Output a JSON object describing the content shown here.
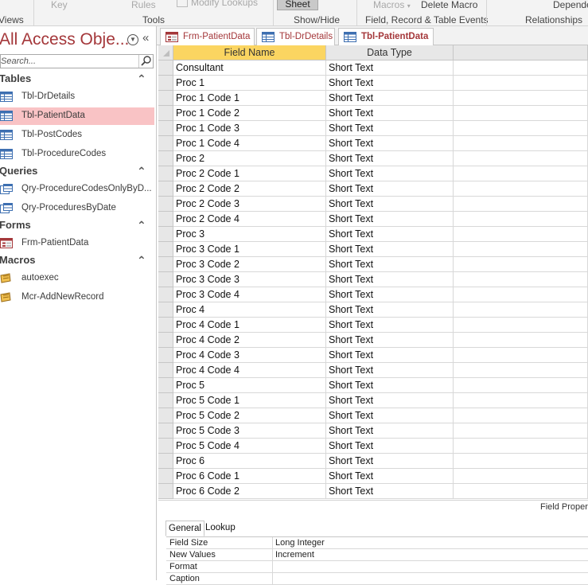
{
  "ribbon": {
    "views_label": "Views",
    "key_label": "Key",
    "rules_label": "Rules",
    "modify_lookups_label": "Modify Lookups",
    "tools_label": "Tools",
    "sheet_label": "Sheet",
    "show_hide_label": "Show/Hide",
    "macros_label": "Macros",
    "delete_macro_label": "Delete Macro",
    "field_events_label": "Field, Record & Table Events",
    "dependencies_label": "Depende",
    "relationships_label": "Relationships"
  },
  "nav": {
    "title": "All Access Obje...",
    "search_placeholder": "Search...",
    "groups": [
      {
        "label": "Tables",
        "items": [
          {
            "label": "Tbl-DrDetails",
            "icon": "table-icon"
          },
          {
            "label": "Tbl-PatientData",
            "icon": "table-icon",
            "selected": true
          },
          {
            "label": "Tbl-PostCodes",
            "icon": "table-icon"
          },
          {
            "label": "Tbl-ProcedureCodes",
            "icon": "table-icon"
          }
        ]
      },
      {
        "label": "Queries",
        "items": [
          {
            "label": "Qry-ProcedureCodesOnlyByD...",
            "icon": "query-icon"
          },
          {
            "label": "Qry-ProceduresByDate",
            "icon": "query-icon"
          }
        ]
      },
      {
        "label": "Forms",
        "items": [
          {
            "label": "Frm-PatientData",
            "icon": "form-icon"
          }
        ]
      },
      {
        "label": "Macros",
        "items": [
          {
            "label": "autoexec",
            "icon": "macro-icon"
          },
          {
            "label": "Mcr-AddNewRecord",
            "icon": "macro-icon"
          }
        ]
      }
    ]
  },
  "tabs": [
    {
      "label": "Frm-PatientData",
      "icon": "form-icon"
    },
    {
      "label": "Tbl-DrDetails",
      "icon": "table-icon"
    },
    {
      "label": "Tbl-PatientData",
      "icon": "table-icon",
      "active": true
    }
  ],
  "grid": {
    "headers": [
      "Field Name",
      "Data Type"
    ],
    "rows": [
      [
        "Consultant",
        "Short Text"
      ],
      [
        "Proc 1",
        "Short Text"
      ],
      [
        "Proc 1 Code 1",
        "Short Text"
      ],
      [
        "Proc 1 Code 2",
        "Short Text"
      ],
      [
        "Proc 1 Code 3",
        "Short Text"
      ],
      [
        "Proc 1 Code 4",
        "Short Text"
      ],
      [
        "Proc 2",
        "Short Text"
      ],
      [
        "Proc 2 Code 1",
        "Short Text"
      ],
      [
        "Proc 2 Code 2",
        "Short Text"
      ],
      [
        "Proc 2 Code 3",
        "Short Text"
      ],
      [
        "Proc 2 Code 4",
        "Short Text"
      ],
      [
        "Proc 3",
        "Short Text"
      ],
      [
        "Proc 3 Code 1",
        "Short Text"
      ],
      [
        "Proc 3 Code 2",
        "Short Text"
      ],
      [
        "Proc 3 Code 3",
        "Short Text"
      ],
      [
        "Proc 3 Code 4",
        "Short Text"
      ],
      [
        "Proc 4",
        "Short Text"
      ],
      [
        "Proc 4 Code 1",
        "Short Text"
      ],
      [
        "Proc 4 Code 2",
        "Short Text"
      ],
      [
        "Proc 4 Code 3",
        "Short Text"
      ],
      [
        "Proc 4 Code 4",
        "Short Text"
      ],
      [
        "Proc 5",
        "Short Text"
      ],
      [
        "Proc 5 Code 1",
        "Short Text"
      ],
      [
        "Proc 5 Code 2",
        "Short Text"
      ],
      [
        "Proc 5 Code 3",
        "Short Text"
      ],
      [
        "Proc 5 Code 4",
        "Short Text"
      ],
      [
        "Proc 6",
        "Short Text"
      ],
      [
        "Proc 6 Code 1",
        "Short Text"
      ],
      [
        "Proc 6 Code 2",
        "Short Text"
      ]
    ]
  },
  "props": {
    "title": "Field Proper",
    "tabs": [
      "General",
      "Lookup"
    ],
    "rows": [
      [
        "Field Size",
        "Long Integer"
      ],
      [
        "New Values",
        "Increment"
      ],
      [
        "Format",
        ""
      ],
      [
        "Caption",
        ""
      ]
    ]
  },
  "colors": {
    "accent": "#a4373a",
    "selection": "#f9c3c5",
    "header_selected": "#fbd561"
  }
}
